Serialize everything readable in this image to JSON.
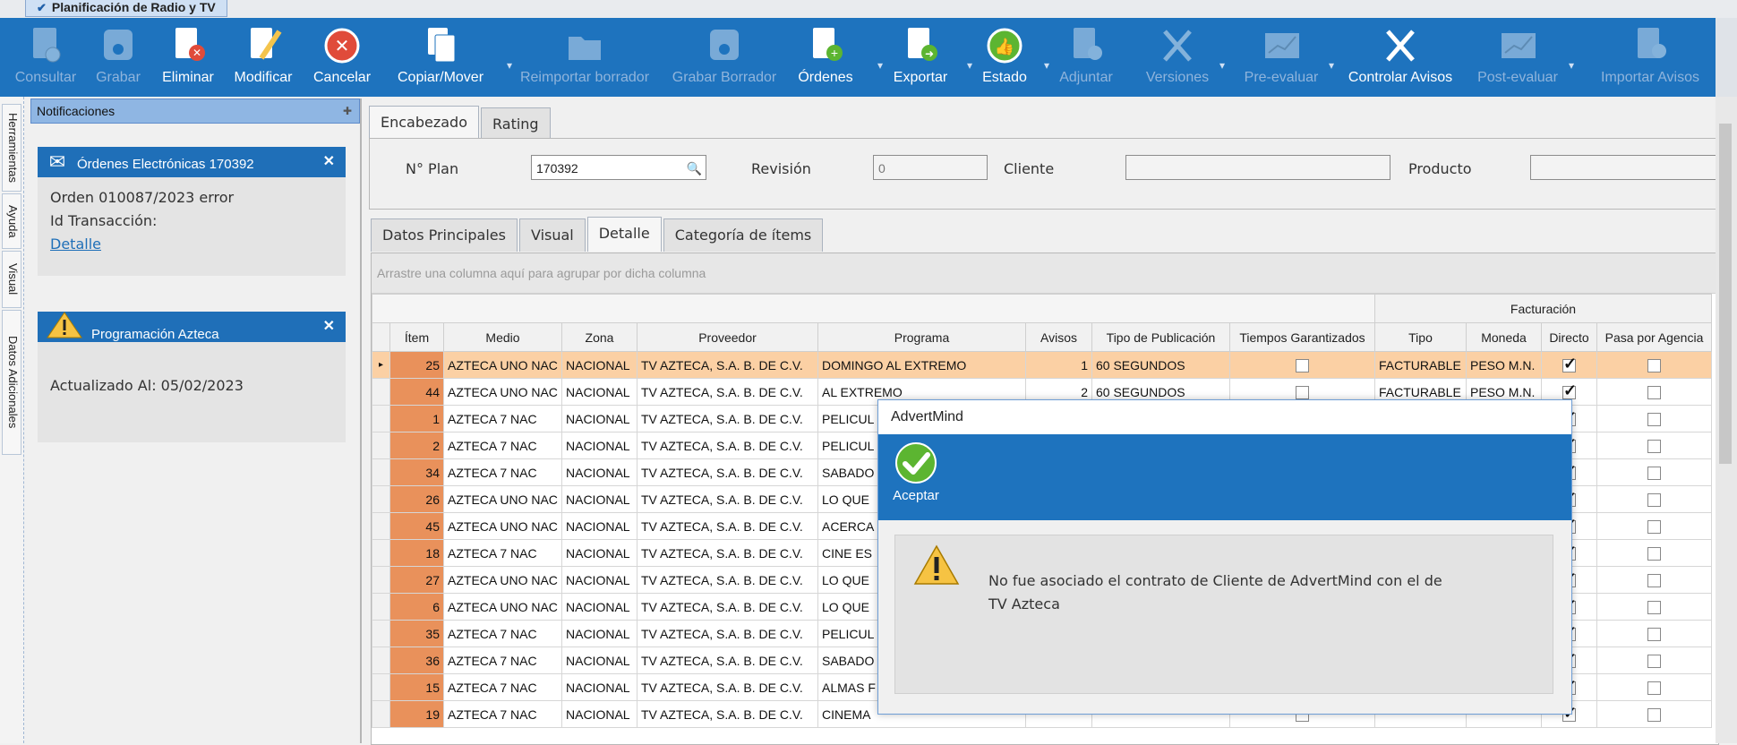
{
  "window": {
    "doc_tab": "Planificación de Radio y TV"
  },
  "ribbon": {
    "buttons": [
      {
        "label": "Consultar",
        "icon": "consult-icon",
        "enabled": false
      },
      {
        "label": "Grabar",
        "icon": "save-icon",
        "enabled": false
      },
      {
        "label": "Eliminar",
        "icon": "delete-doc-icon",
        "enabled": true
      },
      {
        "label": "Modificar",
        "icon": "edit-doc-icon",
        "enabled": true
      },
      {
        "label": "Cancelar",
        "icon": "cancel-icon",
        "enabled": true
      },
      {
        "label": "Copiar/Mover",
        "icon": "copy-icon",
        "enabled": true
      },
      {
        "label": "Reimportar borrador",
        "icon": "folder-icon",
        "enabled": false
      },
      {
        "label": "Grabar Borrador",
        "icon": "save-draft-icon",
        "enabled": false
      },
      {
        "label": "Órdenes",
        "icon": "add-doc-icon",
        "enabled": true
      },
      {
        "label": "Exportar",
        "icon": "export-icon",
        "enabled": true
      },
      {
        "label": "Estado",
        "icon": "thumbs-up-icon",
        "enabled": true
      },
      {
        "label": "Adjuntar",
        "icon": "attach-icon",
        "enabled": false
      },
      {
        "label": "Versiones",
        "icon": "tools-icon",
        "enabled": false
      },
      {
        "label": "Pre-evaluar",
        "icon": "chart-icon",
        "enabled": false
      },
      {
        "label": "Controlar Avisos",
        "icon": "tools-icon",
        "enabled": true
      },
      {
        "label": "Post-evaluar",
        "icon": "chart-icon",
        "enabled": false
      },
      {
        "label": "Importar Avisos",
        "icon": "import-icon",
        "enabled": false
      }
    ]
  },
  "side_tabs": [
    "Herramientas",
    "Ayuda",
    "Visual",
    "Datos Adicionales"
  ],
  "notifications": {
    "title": "Notificaciones",
    "card1": {
      "title": "Órdenes Electrónicas 170392",
      "line1": "Orden 010087/2023 error",
      "line2": "Id Transacción:",
      "link": "Detalle"
    },
    "card2": {
      "title": "Programación Azteca",
      "line1": "Actualizado Al: 05/02/2023"
    }
  },
  "main": {
    "top_tabs": [
      "Encabezado",
      "Rating"
    ],
    "fields": {
      "plan_label": "N° Plan",
      "plan_value": "170392",
      "revision_label": "Revisión",
      "revision_value": "0",
      "cliente_label": "Cliente",
      "producto_label": "Producto"
    },
    "sub_tabs": [
      "Datos Principales",
      "Visual",
      "Detalle",
      "Categoría de ítems"
    ],
    "group_hint": "Arrastre una columna aquí para agrupar por dicha columna",
    "band_header": "Facturación",
    "columns": [
      "Ítem",
      "Medio",
      "Zona",
      "Proveedor",
      "Programa",
      "Avisos",
      "Tipo de Publicación",
      "Tiempos Garantizados",
      "Tipo",
      "Moneda",
      "Directo",
      "Pasa por Agencia"
    ],
    "rows": [
      [
        "25",
        "AZTECA UNO NAC",
        "NACIONAL",
        "TV AZTECA, S.A. B. DE C.V.",
        "DOMINGO AL EXTREMO",
        "1",
        "60 SEGUNDOS",
        false,
        "FACTURABLE",
        "PESO M.N.",
        true,
        false
      ],
      [
        "44",
        "AZTECA UNO NAC",
        "NACIONAL",
        "TV AZTECA, S.A. B. DE C.V.",
        "AL EXTREMO",
        "2",
        "60 SEGUNDOS",
        false,
        "FACTURABLE",
        "PESO M.N.",
        true,
        false
      ],
      [
        "1",
        "AZTECA 7 NAC",
        "NACIONAL",
        "TV AZTECA, S.A. B. DE C.V.",
        "PELICUL",
        "",
        "",
        false,
        "",
        "",
        true,
        false
      ],
      [
        "2",
        "AZTECA 7 NAC",
        "NACIONAL",
        "TV AZTECA, S.A. B. DE C.V.",
        "PELICUL",
        "",
        "",
        false,
        "",
        "",
        true,
        false
      ],
      [
        "34",
        "AZTECA 7 NAC",
        "NACIONAL",
        "TV AZTECA, S.A. B. DE C.V.",
        "SABADO",
        "",
        "",
        false,
        "",
        "",
        true,
        false
      ],
      [
        "26",
        "AZTECA UNO NAC",
        "NACIONAL",
        "TV AZTECA, S.A. B. DE C.V.",
        "LO QUE",
        "",
        "",
        false,
        "",
        "",
        true,
        false
      ],
      [
        "45",
        "AZTECA UNO NAC",
        "NACIONAL",
        "TV AZTECA, S.A. B. DE C.V.",
        "ACERCA",
        "",
        "",
        false,
        "",
        "",
        true,
        false
      ],
      [
        "18",
        "AZTECA 7 NAC",
        "NACIONAL",
        "TV AZTECA, S.A. B. DE C.V.",
        "CINE ES",
        "",
        "",
        false,
        "",
        "",
        true,
        false
      ],
      [
        "27",
        "AZTECA UNO NAC",
        "NACIONAL",
        "TV AZTECA, S.A. B. DE C.V.",
        "LO QUE",
        "",
        "",
        false,
        "",
        "",
        true,
        false
      ],
      [
        "6",
        "AZTECA UNO NAC",
        "NACIONAL",
        "TV AZTECA, S.A. B. DE C.V.",
        "LO QUE",
        "",
        "",
        false,
        "",
        "",
        true,
        false
      ],
      [
        "35",
        "AZTECA 7 NAC",
        "NACIONAL",
        "TV AZTECA, S.A. B. DE C.V.",
        "PELICUL",
        "",
        "",
        false,
        "",
        "",
        true,
        false
      ],
      [
        "36",
        "AZTECA 7 NAC",
        "NACIONAL",
        "TV AZTECA, S.A. B. DE C.V.",
        "SABADO",
        "",
        "",
        false,
        "",
        "",
        true,
        false
      ],
      [
        "15",
        "AZTECA 7 NAC",
        "NACIONAL",
        "TV AZTECA, S.A. B. DE C.V.",
        "ALMAS F",
        "",
        "",
        false,
        "",
        "",
        true,
        false
      ],
      [
        "19",
        "AZTECA 7 NAC",
        "NACIONAL",
        "TV AZTECA, S.A. B. DE C.V.",
        "CINEMA",
        "",
        "",
        false,
        "",
        "",
        true,
        false
      ]
    ]
  },
  "dialog": {
    "title": "AdvertMind",
    "accept_label": "Aceptar",
    "message": "No fue asociado el contrato de Cliente de AdvertMind con el de TV Azteca"
  },
  "colors": {
    "ribbon": "#1e73be",
    "item_cell": "#e9915b",
    "selected_row": "#fbd0a4"
  }
}
